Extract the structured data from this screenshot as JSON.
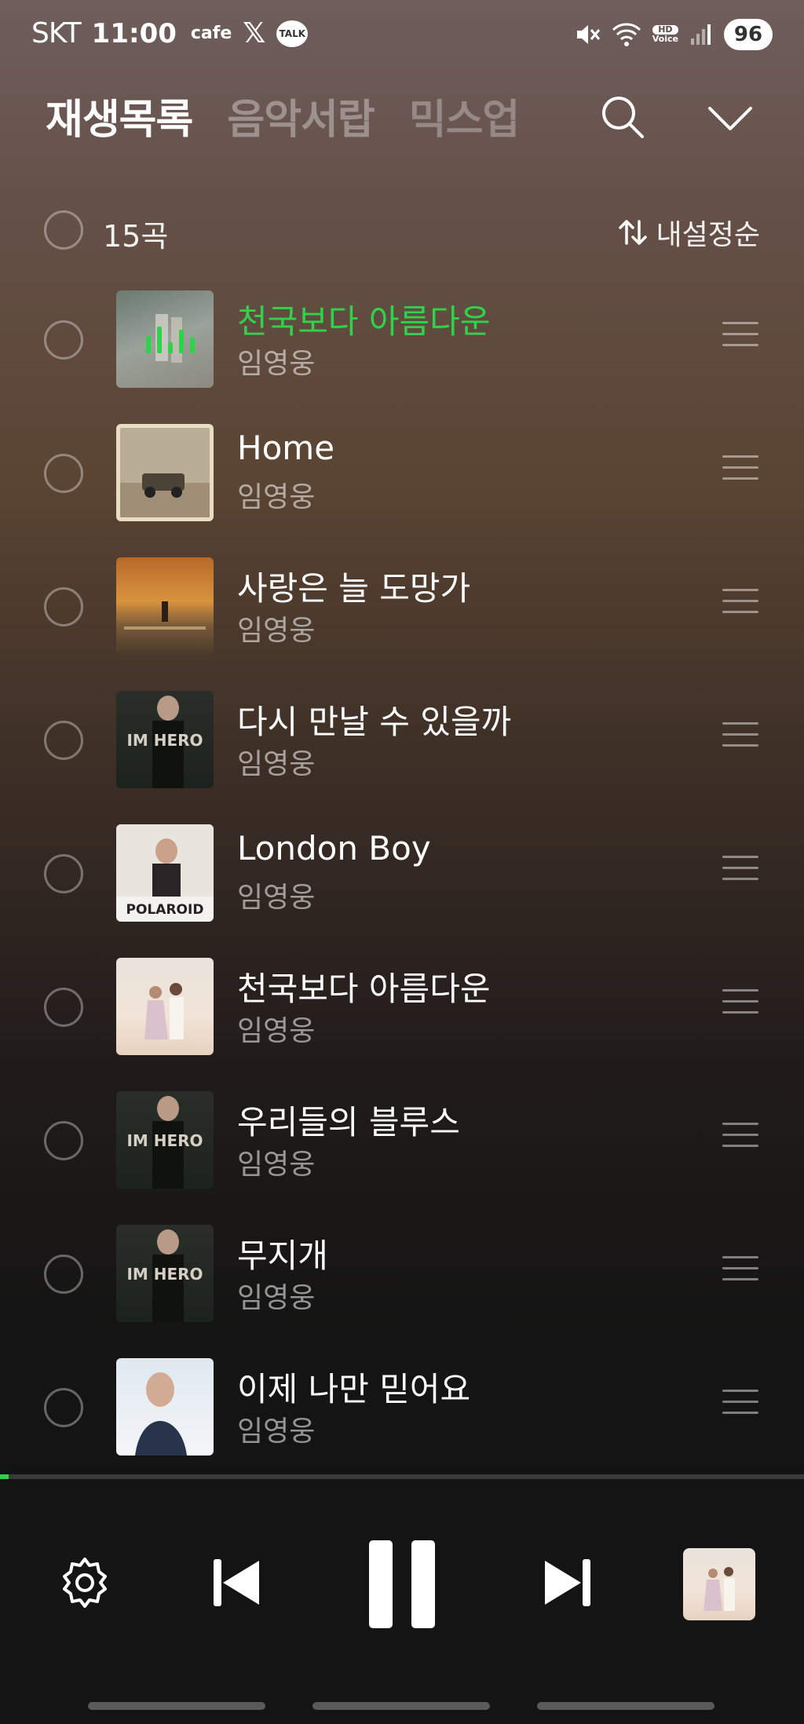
{
  "status_bar": {
    "carrier": "SKT",
    "time": "11:00",
    "cafe": "cafe",
    "x_logo": "𝕏",
    "talk": "TALK",
    "hd_top": "HD",
    "hd_bottom": "Voice",
    "battery": "96",
    "icons": [
      "mute-icon",
      "wifi-icon",
      "signal-icon"
    ]
  },
  "header": {
    "tabs": [
      {
        "label": "재생목록",
        "active": true
      },
      {
        "label": "음악서랍",
        "active": false
      },
      {
        "label": "믹스업",
        "active": false
      }
    ],
    "icons": [
      "search-icon",
      "chevron-down-icon"
    ]
  },
  "selection": {
    "count_label": "15곡",
    "sort_label": "내설정순"
  },
  "tracks": [
    {
      "title": "천국보다 아름다운",
      "artist": "임영웅",
      "playing": true
    },
    {
      "title": "Home",
      "artist": "임영웅",
      "playing": false
    },
    {
      "title": "사랑은 늘 도망가",
      "artist": "임영웅",
      "playing": false
    },
    {
      "title": "다시 만날 수 있을까",
      "artist": "임영웅",
      "playing": false
    },
    {
      "title": "London Boy",
      "artist": "임영웅",
      "playing": false
    },
    {
      "title": "천국보다 아름다운",
      "artist": "임영웅",
      "playing": false
    },
    {
      "title": "우리들의 블루스",
      "artist": "임영웅",
      "playing": false
    },
    {
      "title": "무지개",
      "artist": "임영웅",
      "playing": false
    },
    {
      "title": "이제 나만 믿어요",
      "artist": "임영웅",
      "playing": false
    }
  ],
  "album_art_text": {
    "im_hero": "IM HERO",
    "polaroid": "POLAROID"
  },
  "player": {
    "progress_fraction": 0.011,
    "controls": [
      "settings-icon",
      "previous-icon",
      "pause-icon",
      "next-icon"
    ]
  },
  "colors": {
    "accent_green": "#2fd34a",
    "player_bg": "#141414"
  }
}
